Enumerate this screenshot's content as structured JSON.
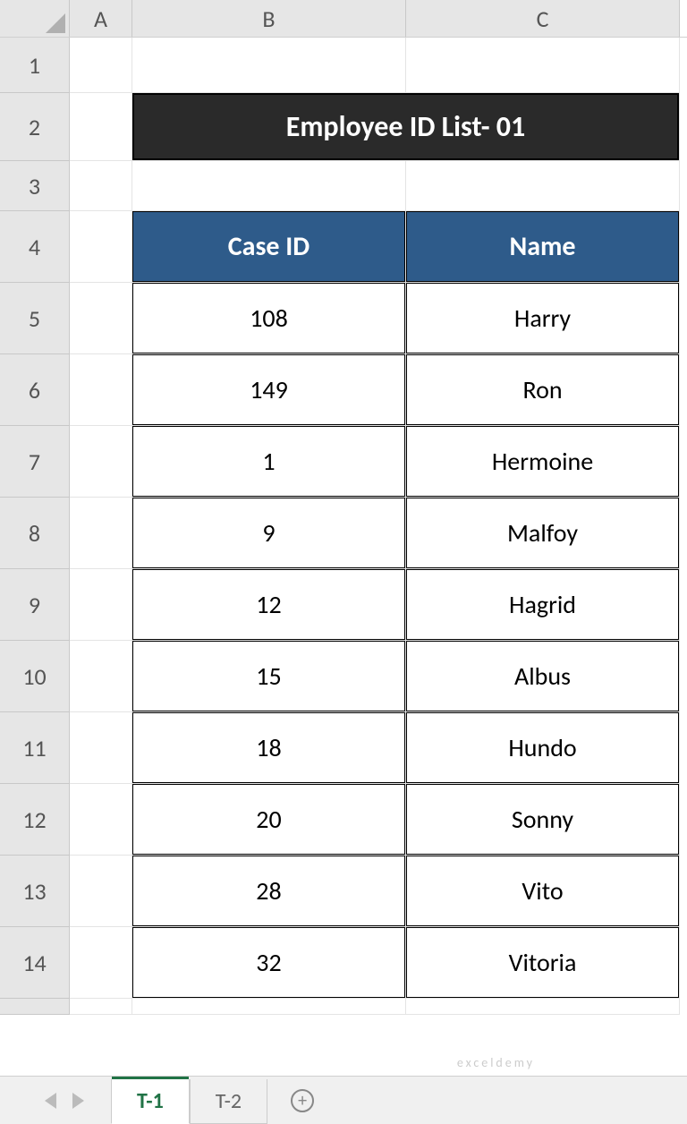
{
  "columns": [
    "A",
    "B",
    "C"
  ],
  "rows": [
    "1",
    "2",
    "3",
    "4",
    "5",
    "6",
    "7",
    "8",
    "9",
    "10",
    "11",
    "12",
    "13",
    "14"
  ],
  "title": "Employee ID List- 01",
  "headers": {
    "col_b": "Case ID",
    "col_c": "Name"
  },
  "table": [
    {
      "case_id": "108",
      "name": "Harry"
    },
    {
      "case_id": "149",
      "name": "Ron"
    },
    {
      "case_id": "1",
      "name": "Hermoine"
    },
    {
      "case_id": "9",
      "name": "Malfoy"
    },
    {
      "case_id": "12",
      "name": "Hagrid"
    },
    {
      "case_id": "15",
      "name": "Albus"
    },
    {
      "case_id": "18",
      "name": "Hundo"
    },
    {
      "case_id": "20",
      "name": "Sonny"
    },
    {
      "case_id": "28",
      "name": "Vito"
    },
    {
      "case_id": "32",
      "name": "Vitoria"
    }
  ],
  "tabs": {
    "active": "T-1",
    "inactive": "T-2"
  },
  "watermark": "exceldemy"
}
